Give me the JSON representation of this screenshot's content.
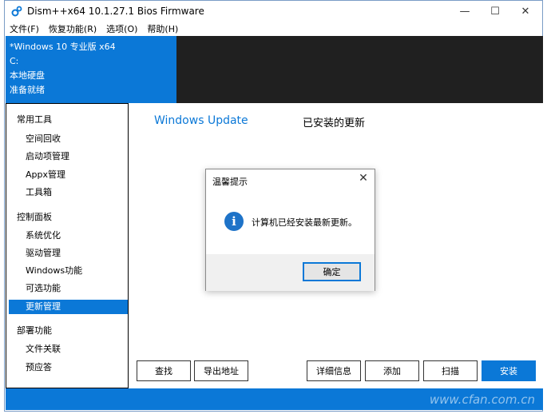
{
  "window": {
    "title": "Dism++x64 10.1.27.1 Bios Firmware",
    "controls": {
      "minimize": "—",
      "maximize": "☐",
      "close": "✕"
    }
  },
  "menu": [
    "文件(F)",
    "恢复功能(R)",
    "选项(O)",
    "帮助(H)"
  ],
  "info_panel": {
    "os": "*Windows 10 专业版 x64",
    "drive": "C:",
    "disk_type": "本地硬盘",
    "status": "准备就绪"
  },
  "sidebar": {
    "group1": "常用工具",
    "group1_items": [
      "空间回收",
      "启动项管理",
      "Appx管理",
      "工具箱"
    ],
    "group2": "控制面板",
    "group2_items": [
      "系统优化",
      "驱动管理",
      "Windows功能",
      "可选功能",
      "更新管理"
    ],
    "group3": "部署功能",
    "group3_items": [
      "文件关联",
      "预应答"
    ]
  },
  "content": {
    "tab_update": "Windows Update",
    "tab_installed": "已安装的更新"
  },
  "buttons": {
    "find": "查找",
    "export": "导出地址",
    "details": "详细信息",
    "add": "添加",
    "scan": "扫描",
    "install": "安装"
  },
  "dialog": {
    "title": "温馨提示",
    "close": "✕",
    "icon_glyph": "i",
    "message": "计算机已经安装最新更新。",
    "ok": "确定"
  },
  "watermark": "www.cfan.com.cn",
  "colors": {
    "accent": "#0b78d7",
    "dark": "#202020"
  },
  "icons": {
    "app": "gear-icon",
    "dialog": "info-icon"
  }
}
